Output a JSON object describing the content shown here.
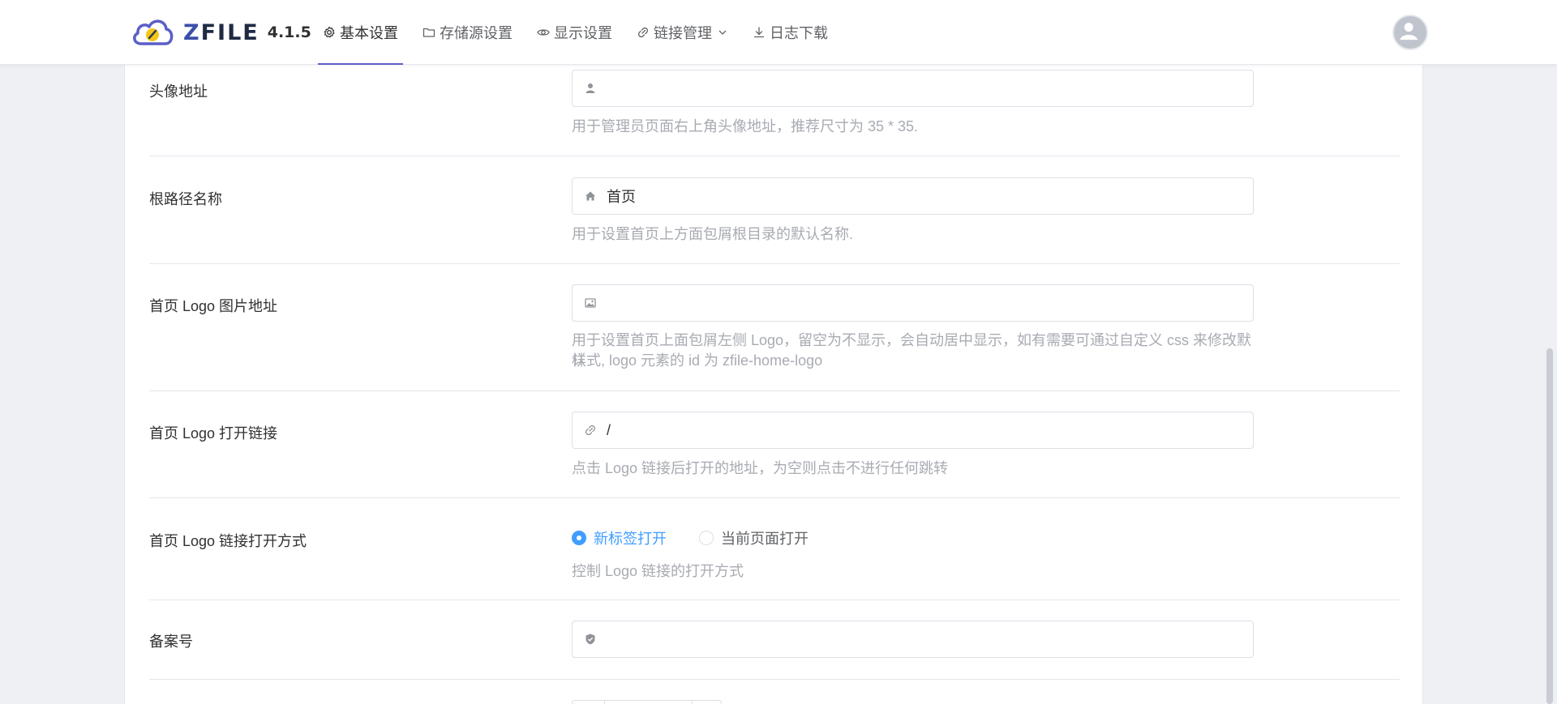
{
  "header": {
    "brand": "ZFILE",
    "version": "4.1.5",
    "nav": [
      {
        "label": "基本设置",
        "icon": "gear-icon"
      },
      {
        "label": "存储源设置",
        "icon": "folder-icon"
      },
      {
        "label": "显示设置",
        "icon": "eye-icon"
      },
      {
        "label": "链接管理",
        "icon": "link-icon"
      },
      {
        "label": "日志下载",
        "icon": "download-icon"
      }
    ],
    "active_tab": "基本设置",
    "avatar_icon": "user-avatar-icon"
  },
  "form": {
    "avatar_url": {
      "label": "头像地址",
      "value": "",
      "icon": "user-icon",
      "hint": "用于管理员页面右上角头像地址，推荐尺寸为 35 * 35."
    },
    "root_name": {
      "label": "根路径名称",
      "value": "首页",
      "icon": "home-icon",
      "hint": "用于设置首页上方面包屑根目录的默认名称."
    },
    "logo_url": {
      "label": "首页 Logo 图片地址",
      "value": "",
      "icon": "image-icon",
      "hint_line1": "用于设置首页上面包屑左侧 Logo，留空为不显示，会自动居中显示，如有需要可通过自定义 css 来修改默认",
      "hint_line2": "样式, logo 元素的 id 为 zfile-home-logo"
    },
    "logo_link": {
      "label": "首页 Logo 打开链接",
      "value": "/",
      "icon": "link-icon",
      "hint": "点击 Logo 链接后打开的地址，为空则点击不进行任何跳转"
    },
    "logo_target": {
      "label": "首页 Logo 链接打开方式",
      "options": [
        "新标签打开",
        "当前页面打开"
      ],
      "selected": "新标签打开",
      "hint": "控制 Logo 链接的打开方式"
    },
    "icp": {
      "label": "备案号",
      "value": "",
      "icon": "shield-icon"
    }
  },
  "colors": {
    "accent": "#5b5fc7",
    "primary": "#409eff",
    "hint_text": "#a8abb2",
    "background": "#eef0f3"
  }
}
